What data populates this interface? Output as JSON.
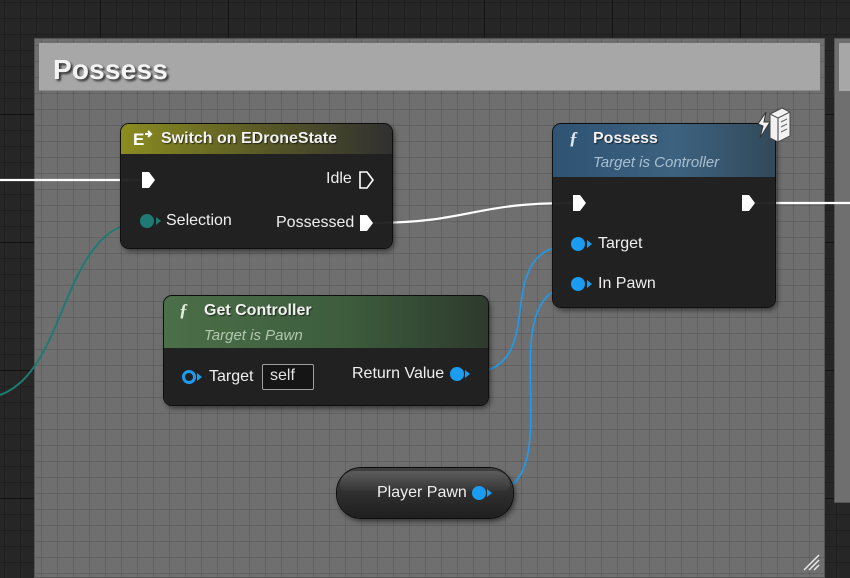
{
  "comment": {
    "title": "Possess"
  },
  "switch_node": {
    "title": "Switch on EDroneState",
    "pins": {
      "selection": "Selection",
      "idle": "Idle",
      "possessed": "Possessed"
    },
    "header_color": "#8b8c20"
  },
  "possess_node": {
    "title": "Possess",
    "subtitle": "Target is Controller",
    "pins": {
      "target": "Target",
      "in_pawn": "In Pawn"
    },
    "header_color": "#3c6280"
  },
  "get_controller_node": {
    "title": "Get Controller",
    "subtitle": "Target is Pawn",
    "pins": {
      "target": "Target",
      "target_default": "self",
      "return_value": "Return Value"
    },
    "header_color": "#4b6f48"
  },
  "player_pawn_node": {
    "label": "Player Pawn"
  },
  "colors": {
    "object_pin": "#1b9cf0",
    "enum_pin": "#1e7a73",
    "exec_wire": "#ffffff",
    "graph_bg": "#262626",
    "comment_bg": "#6f6f6f"
  },
  "icons": {
    "function": "function-icon",
    "enum_switch": "switch-enum-icon",
    "latent": "server-authority-icon"
  }
}
